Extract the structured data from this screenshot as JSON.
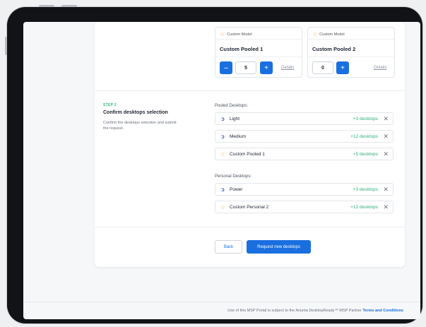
{
  "models": [
    {
      "tag": "Custom Model",
      "title": "Custom Pooled 1",
      "quantity": "5",
      "minus": "–",
      "plus": "+",
      "details": "Details"
    },
    {
      "tag": "Custom Model",
      "title": "Custom Pooled 2",
      "quantity": "0",
      "plus": "+",
      "details": "Details"
    }
  ],
  "step": {
    "label": "STEP 2",
    "title": "Confirm desktops selection",
    "description": "Confirm the desktops selection and submit the request."
  },
  "pooled": {
    "label": "Pooled Desktops:",
    "items": [
      {
        "name": "Light",
        "count": "+3 desktops",
        "icon": "brand-icon"
      },
      {
        "name": "Medium",
        "count": "+12 desktops",
        "icon": "brand-icon"
      },
      {
        "name": "Custom Pooled 1",
        "count": "+5 desktops",
        "icon": "star-icon"
      }
    ]
  },
  "personal": {
    "label": "Personal Desktops:",
    "items": [
      {
        "name": "Power",
        "count": "+3 desktops",
        "icon": "brand-icon"
      },
      {
        "name": "Custom Personal 2",
        "count": "+12 desktops",
        "icon": "star-icon"
      }
    ]
  },
  "actions": {
    "back": "Back",
    "request": "Request new desktops"
  },
  "footer": {
    "text": "Use of this MSP Portal is subject to the Anunta DesktopReady™ MSP Partner",
    "link": "Terms and Conditions"
  },
  "colors": {
    "accent": "#1a6fe0",
    "success": "#2bb37a",
    "star": "#f2a93b"
  }
}
